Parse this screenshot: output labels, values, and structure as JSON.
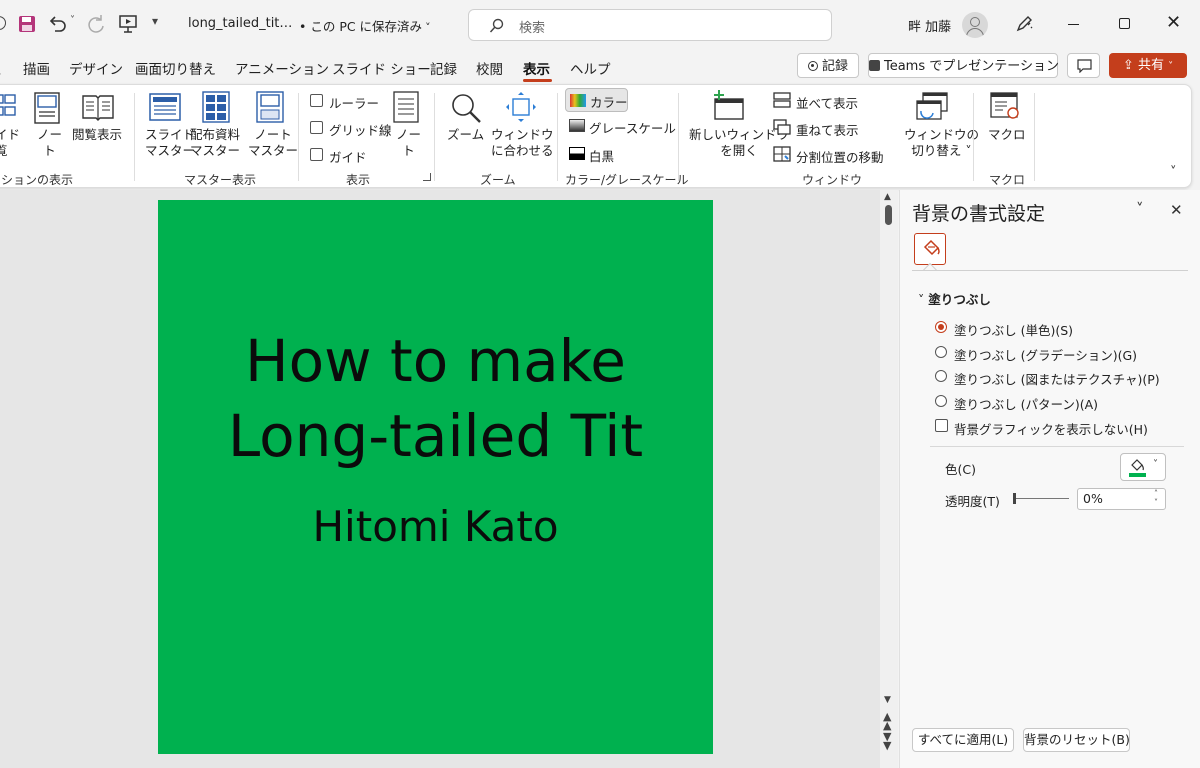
{
  "titlebar": {
    "filename": "long_tailed_tit…",
    "save_status": "• この PC に保存済み",
    "search_placeholder": "検索",
    "user_name": "畔 加藤"
  },
  "tabs": [
    "描画",
    "デザイン",
    "画面切り替え",
    "アニメーション",
    "スライド ショー",
    "記録",
    "校閲",
    "表示",
    "ヘルプ"
  ],
  "active_tab": "表示",
  "header_buttons": {
    "record": "記録",
    "teams": "Teams でプレゼンテーション",
    "share": "共有"
  },
  "ribbon": {
    "presentation_views": {
      "slide": "イド\n覧",
      "note": "ノー\nト",
      "reading": "閲覧表示",
      "group_label": "ションの表示"
    },
    "master_views": {
      "slide_master": "スライド\nマスター",
      "handout_master": "配布資料\nマスター",
      "notes_master": "ノート\nマスター",
      "group_label": "マスター表示"
    },
    "show": {
      "ruler": "ルーラー",
      "gridlines": "グリッド線",
      "guides": "ガイド",
      "notes": "ノー\nト",
      "group_label": "表示"
    },
    "zoom": {
      "zoom": "ズーム",
      "fit": "ウィンドウ\nに合わせる",
      "group_label": "ズーム"
    },
    "color": {
      "color": "カラー",
      "grayscale": "グレースケール",
      "bw": "白黒",
      "group_label": "カラー/グレースケール"
    },
    "window": {
      "new_window": "新しいウィンドウ\nを開く",
      "arrange_all": "並べて表示",
      "cascade": "重ねて表示",
      "move_split": "分割位置の移動",
      "switch_windows": "ウィンドウの\n切り替え ˅",
      "group_label": "ウィンドウ"
    },
    "macros": {
      "macro": "マクロ",
      "group_label": "マクロ"
    }
  },
  "slide": {
    "title_line1": "How to make",
    "title_line2": "Long-tailed Tit",
    "subtitle": "Hitomi Kato",
    "background_color": "#00b14f"
  },
  "format_pane": {
    "title": "背景の書式設定",
    "section": "塗りつぶし",
    "options": [
      {
        "label": "塗りつぶし (単色)(S)",
        "selected": true
      },
      {
        "label": "塗りつぶし (グラデーション)(G)",
        "selected": false
      },
      {
        "label": "塗りつぶし (図またはテクスチャ)(P)",
        "selected": false
      },
      {
        "label": "塗りつぶし (パターン)(A)",
        "selected": false
      }
    ],
    "hide_graphics": "背景グラフィックを表示しない(H)",
    "color_label": "色(C)",
    "transparency_label": "透明度(T)",
    "transparency_value": "0%",
    "apply_all": "すべてに適用(L)",
    "reset": "背景のリセット(B)"
  }
}
